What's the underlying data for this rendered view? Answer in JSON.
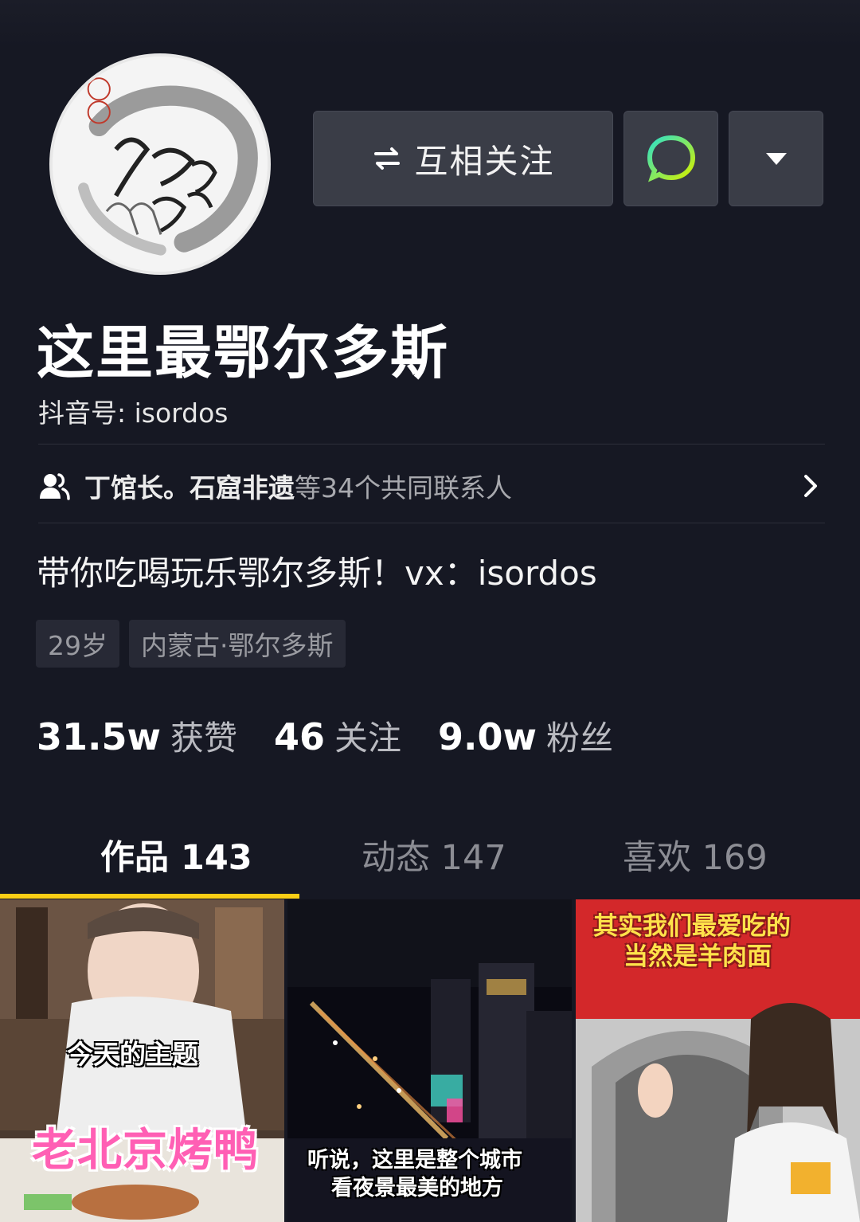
{
  "profile": {
    "avatar_alt": "这里 最鄂尔多斯 Discover Ordos",
    "name": "这里最鄂尔多斯",
    "handle_label": "抖音号: ",
    "handle": "isordos",
    "bio": "带你吃喝玩乐鄂尔多斯！vx：isordos"
  },
  "actions": {
    "follow_label": "互相关注",
    "follow_icon": "mutual-follow-icon",
    "message_icon": "message-bubble-icon",
    "more_icon": "dropdown-caret-icon"
  },
  "mutual": {
    "names": "丁馆长。石窟非遗",
    "suffix": "等34个共同联系人"
  },
  "tags": [
    "29岁",
    "内蒙古·鄂尔多斯"
  ],
  "stats": [
    {
      "num": "31.5w",
      "label": "获赞"
    },
    {
      "num": "46",
      "label": "关注"
    },
    {
      "num": "9.0w",
      "label": "粉丝"
    }
  ],
  "tabs": [
    {
      "label": "作品 143",
      "active": true
    },
    {
      "label": "动态 147",
      "active": false
    },
    {
      "label": "喜欢 169",
      "active": false
    }
  ],
  "videos": [
    {
      "caption1": "今天的主题",
      "caption2": "老北京烤鸭"
    },
    {
      "caption1": "听说，这里是整个城市",
      "caption2": "看夜景最美的地方"
    },
    {
      "caption1": "其实我们最爱吃的",
      "caption2": "当然是羊肉面"
    }
  ],
  "colors": {
    "background": "#161823",
    "accent_underline": "#face15",
    "button_bg": "#3a3d47"
  }
}
